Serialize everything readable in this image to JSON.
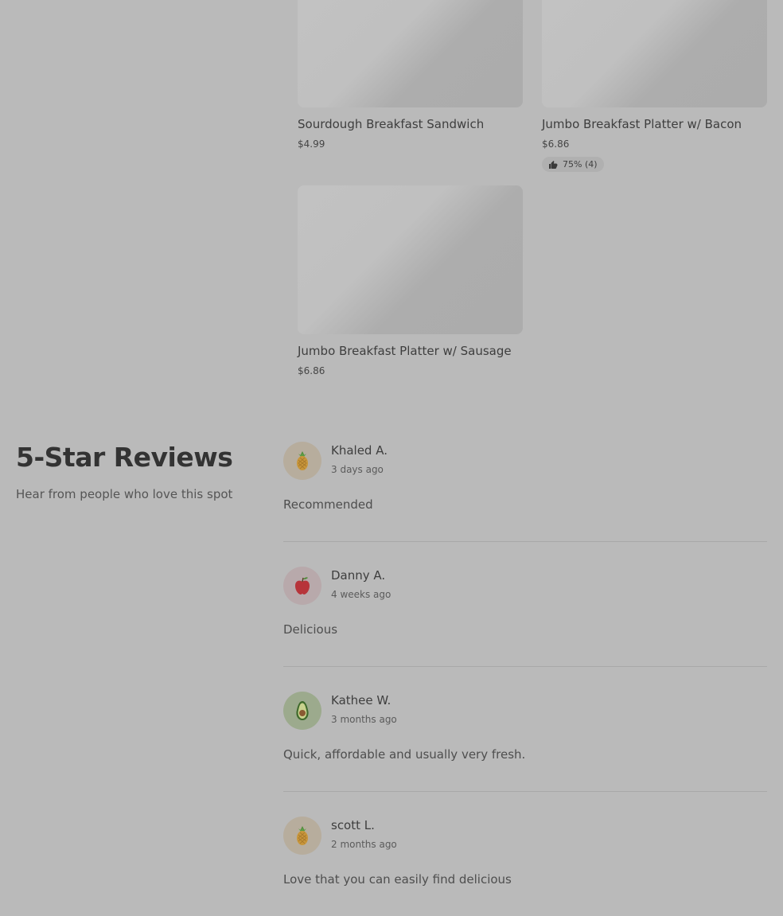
{
  "menu_items": [
    {
      "name": "Sourdough Breakfast Sandwich",
      "price": "$4.99",
      "rating": null
    },
    {
      "name": "Jumbo Breakfast Platter w/ Bacon",
      "price": "$6.86",
      "rating": "75% (4)"
    },
    {
      "name": "Jumbo Breakfast Platter w/ Sausage",
      "price": "$6.86",
      "rating": null
    }
  ],
  "reviews_section": {
    "title": "5-Star Reviews",
    "subtitle": "Hear from people who love this spot"
  },
  "reviews": [
    {
      "name": "Khaled A.",
      "time": "3 days ago",
      "text": "Recommended",
      "avatar": "pineapple-icon",
      "avatar_color": "#b7ad9d"
    },
    {
      "name": "Danny A.",
      "time": "4 weeks ago",
      "text": "Delicious",
      "avatar": "apple-icon",
      "avatar_color": "#b8a9ab"
    },
    {
      "name": "Kathee W.",
      "time": "3 months ago",
      "text": "Quick, affordable and usually very fresh.",
      "avatar": "avocado-icon",
      "avatar_color": "#9caa8d"
    },
    {
      "name": "scott L.",
      "time": "2 months ago",
      "text": "Love that you can easily find delicious",
      "avatar": "pineapple-icon",
      "avatar_color": "#b7ad9d"
    }
  ],
  "colors": {
    "overlay": "#bababa",
    "divider": "#a9a9a9"
  }
}
